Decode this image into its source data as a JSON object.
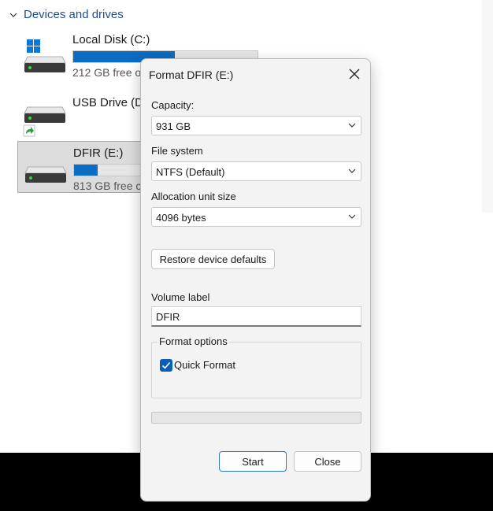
{
  "explorer": {
    "section_title": "Devices and drives",
    "drives": [
      {
        "name": "Local Disk (C:)",
        "free_text": "212 GB free o",
        "used_fraction": 0.55
      },
      {
        "name": "USB Drive (D",
        "free_text": ""
      },
      {
        "name": "DFIR (E:)",
        "free_text": "813 GB free c",
        "used_fraction": 0.13
      }
    ]
  },
  "dialog": {
    "title": "Format DFIR (E:)",
    "capacity_label": "Capacity:",
    "capacity_value": "931 GB",
    "filesystem_label": "File system",
    "filesystem_value": "NTFS (Default)",
    "allocation_label": "Allocation unit size",
    "allocation_value": "4096 bytes",
    "restore_label": "Restore device defaults",
    "volume_label": "Volume label",
    "volume_value": "DFIR",
    "options_title": "Format options",
    "quick_format_label": "Quick Format",
    "quick_format_checked": true,
    "progress_fraction": 0,
    "start_label": "Start",
    "close_label": "Close"
  },
  "colors": {
    "accent": "#0a6cc2",
    "checkbox": "#0a5fb4",
    "section_title": "#1f4e8c"
  },
  "icons": [
    "chevron-down-icon",
    "windows-logo-icon",
    "hard-drive-icon",
    "shortcut-arrow-icon",
    "close-icon"
  ]
}
